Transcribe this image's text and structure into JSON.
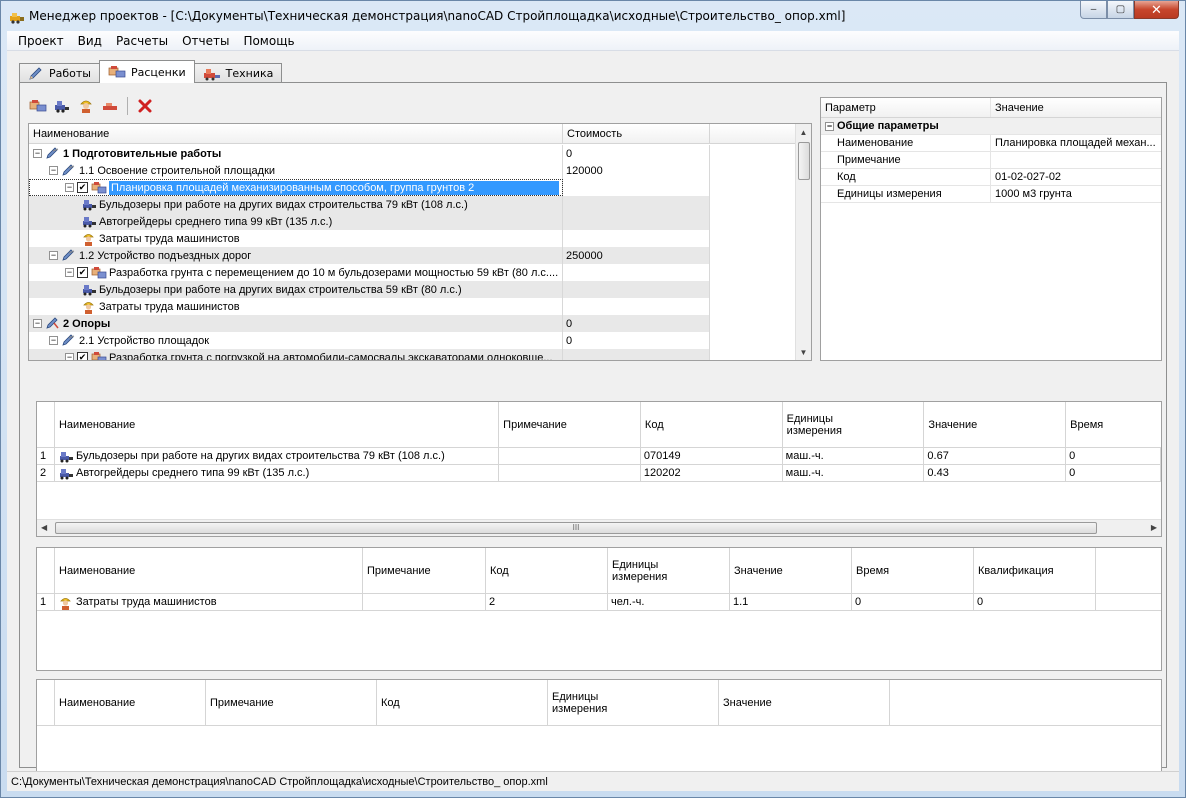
{
  "window": {
    "title": "Менеджер проектов - [C:\\Документы\\Техническая демонстрация\\nanoCAD Стройплощадка\\исходные\\Строительство_ опор.xml]",
    "minimize": "–",
    "maximize": "▢",
    "close": "✕"
  },
  "menu": [
    "Проект",
    "Вид",
    "Расчеты",
    "Отчеты",
    "Помощь"
  ],
  "tabs": [
    {
      "label": "Работы",
      "icon": "pencil-icon"
    },
    {
      "label": "Расценки",
      "icon": "price-icon",
      "active": true
    },
    {
      "label": "Техника",
      "icon": "machinery-icon"
    }
  ],
  "tree": {
    "headers": {
      "name": "Наименование",
      "cost": "Стоимость"
    },
    "rows": [
      {
        "level": 0,
        "expander": "−",
        "icon": "work-icon",
        "label": "1 Подготовительные работы",
        "cost": "0",
        "bold": true
      },
      {
        "level": 1,
        "expander": "−",
        "icon": "work-icon",
        "label": "1.1 Освоение строительной площадки",
        "cost": "120000"
      },
      {
        "level": 2,
        "expander": "−",
        "checked": true,
        "icon": "price-icon",
        "label": "Планировка площадей механизированным способом, группа грунтов 2",
        "cost": "",
        "selected": true
      },
      {
        "level": 3,
        "icon": "bulldozer-icon",
        "label": "Бульдозеры при работе на других видах строительства 79 кВт (108 л.с.)",
        "cost": "",
        "alt": true
      },
      {
        "level": 3,
        "icon": "bulldozer-icon",
        "label": "Автогрейдеры среднего типа 99 кВт (135 л.с.)",
        "cost": "",
        "alt": true
      },
      {
        "level": 3,
        "icon": "worker-icon",
        "label": "Затраты труда машинистов",
        "cost": ""
      },
      {
        "level": 1,
        "expander": "−",
        "icon": "work-icon",
        "label": "1.2 Устройство подъездных дорог",
        "cost": "250000",
        "alt": true
      },
      {
        "level": 2,
        "expander": "−",
        "checked": true,
        "icon": "price-icon",
        "label": "Разработка грунта с перемещением до 10 м бульдозерами мощностью 59 кВт (80 л.с....",
        "cost": ""
      },
      {
        "level": 3,
        "icon": "bulldozer-icon",
        "label": "Бульдозеры при работе на других видах строительства 59 кВт (80 л.с.)",
        "cost": "",
        "alt": true
      },
      {
        "level": 3,
        "icon": "worker-icon",
        "label": "Затраты труда машинистов",
        "cost": ""
      },
      {
        "level": 0,
        "expander": "−",
        "icon": "support-icon",
        "label": "2 Опоры",
        "cost": "0",
        "bold": true,
        "alt": true
      },
      {
        "level": 1,
        "expander": "−",
        "icon": "work-icon",
        "label": "2.1 Устройство площадок",
        "cost": "0"
      },
      {
        "level": 2,
        "expander": "−",
        "checked": true,
        "icon": "price-icon",
        "label": "Разработка грунта с погрузкой на автомобили-самосвалы экскаваторами одноковше...",
        "cost": "",
        "alt": true
      }
    ]
  },
  "props": {
    "headers": {
      "param": "Параметр",
      "value": "Значение"
    },
    "category": "Общие параметры",
    "category_toggle": "−",
    "rows": [
      {
        "param": "Наименование",
        "value": "Планировка площадей механ..."
      },
      {
        "param": "Примечание",
        "value": ""
      },
      {
        "param": "Код",
        "value": "01-02-027-02"
      },
      {
        "param": "Единицы измерения",
        "value": "1000 м3 грунта"
      }
    ]
  },
  "machines_grid": {
    "headers": [
      "Наименование",
      "Примечание",
      "Код",
      "Единицы\nизмерения",
      "Значение",
      "Время"
    ],
    "rows": [
      {
        "num": "1",
        "name": "Бульдозеры при работе на других видах строительства 79 кВт (108 л.с.)",
        "note": "",
        "code": "070149",
        "unit": "маш.-ч.",
        "value": "0.67",
        "time": "0"
      },
      {
        "num": "2",
        "name": "Автогрейдеры среднего типа 99 кВт (135 л.с.)",
        "note": "",
        "code": "120202",
        "unit": "маш.-ч.",
        "value": "0.43",
        "time": "0"
      }
    ],
    "scroll_grip": "III",
    "scroll_left": "◀",
    "scroll_right": "▶"
  },
  "labor_grid": {
    "headers": [
      "Наименование",
      "Примечание",
      "Код",
      "Единицы\nизмерения",
      "Значение",
      "Время",
      "Квалификация"
    ],
    "rows": [
      {
        "num": "1",
        "name": "Затраты труда машинистов",
        "note": "",
        "code": "2",
        "unit": "чел.-ч.",
        "value": "1.1",
        "time": "0",
        "qual": "0"
      }
    ]
  },
  "materials_grid": {
    "headers": [
      "Наименование",
      "Примечание",
      "Код",
      "Единицы\nизмерения",
      "Значение"
    ]
  },
  "statusbar": {
    "path": "C:\\Документы\\Техническая демонстрация\\nanoCAD Стройплощадка\\исходные\\Строительство_ опор.xml"
  }
}
